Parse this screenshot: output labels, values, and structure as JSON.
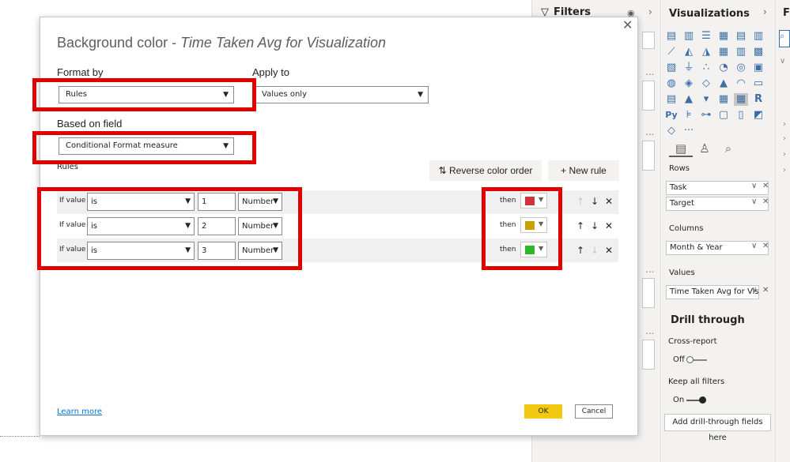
{
  "filters_pane": {
    "title": "Filters",
    "dots_label": "..."
  },
  "viz_pane": {
    "title": "Visualizations",
    "icons": [
      "stacked-bar-icon",
      "clustered-column-icon",
      "clustered-bar-icon",
      "column-icon",
      "stacked-bar-100-icon",
      "column-100-icon",
      "line-chart-icon",
      "area-chart-icon",
      "stacked-area-icon",
      "line-column-icon",
      "line-clustered-icon",
      "ribbon-chart-icon",
      "waterfall-icon",
      "funnel-icon",
      "scatter-icon",
      "pie-icon",
      "donut-icon",
      "treemap-icon",
      "map-icon",
      "filled-map-icon",
      "shape-map-icon",
      "azure-map-icon",
      "gauge-icon",
      "card-icon",
      "multi-row-card-icon",
      "kpi-icon",
      "slicer-icon",
      "table-icon",
      "matrix-icon",
      "r-visual-icon",
      "python-visual-icon",
      "key-influencers-icon",
      "decomposition-tree-icon",
      "qa-icon",
      "paginated-report-icon",
      "power-apps-icon",
      "get-more-visuals-icon",
      "more-options-icon"
    ],
    "python_label": "Py",
    "r_label": "R",
    "more_label": "···",
    "rows_label": "Rows",
    "rows": [
      "Task",
      "Target"
    ],
    "columns_label": "Columns",
    "columns": [
      "Month & Year"
    ],
    "values_label": "Values",
    "values": [
      "Time Taken Avg for Visu"
    ],
    "drill_title": "Drill through",
    "cross_report_label": "Cross-report",
    "cross_report_state": "Off",
    "keep_filters_label": "Keep all filters",
    "keep_filters_state": "On",
    "add_drill_label": "Add drill-through fields here"
  },
  "right_strip": {
    "letter": "F"
  },
  "dialog": {
    "title_prefix": "Background color - ",
    "title_field": "Time Taken Avg for Visualization",
    "format_by_label": "Format by",
    "format_by_value": "Rules",
    "apply_to_label": "Apply to",
    "apply_to_value": "Values only",
    "based_on_label": "Based on field",
    "based_on_value": "Conditional Format measure",
    "rules_label": "Rules",
    "reverse_label": "Reverse color order",
    "new_rule_label": "New rule",
    "rules": [
      {
        "if_label": "If value",
        "operator": "is",
        "value": "1",
        "type": "Number",
        "then": "then",
        "color": "#d13438",
        "up_enabled": false,
        "down_enabled": true
      },
      {
        "if_label": "If value",
        "operator": "is",
        "value": "2",
        "type": "Number",
        "then": "then",
        "color": "#c8a000",
        "up_enabled": true,
        "down_enabled": true
      },
      {
        "if_label": "If value",
        "operator": "is",
        "value": "3",
        "type": "Number",
        "then": "then",
        "color": "#2eb82e",
        "up_enabled": true,
        "down_enabled": false
      }
    ],
    "learn_more": "Learn more",
    "ok": "OK",
    "cancel": "Cancel"
  }
}
